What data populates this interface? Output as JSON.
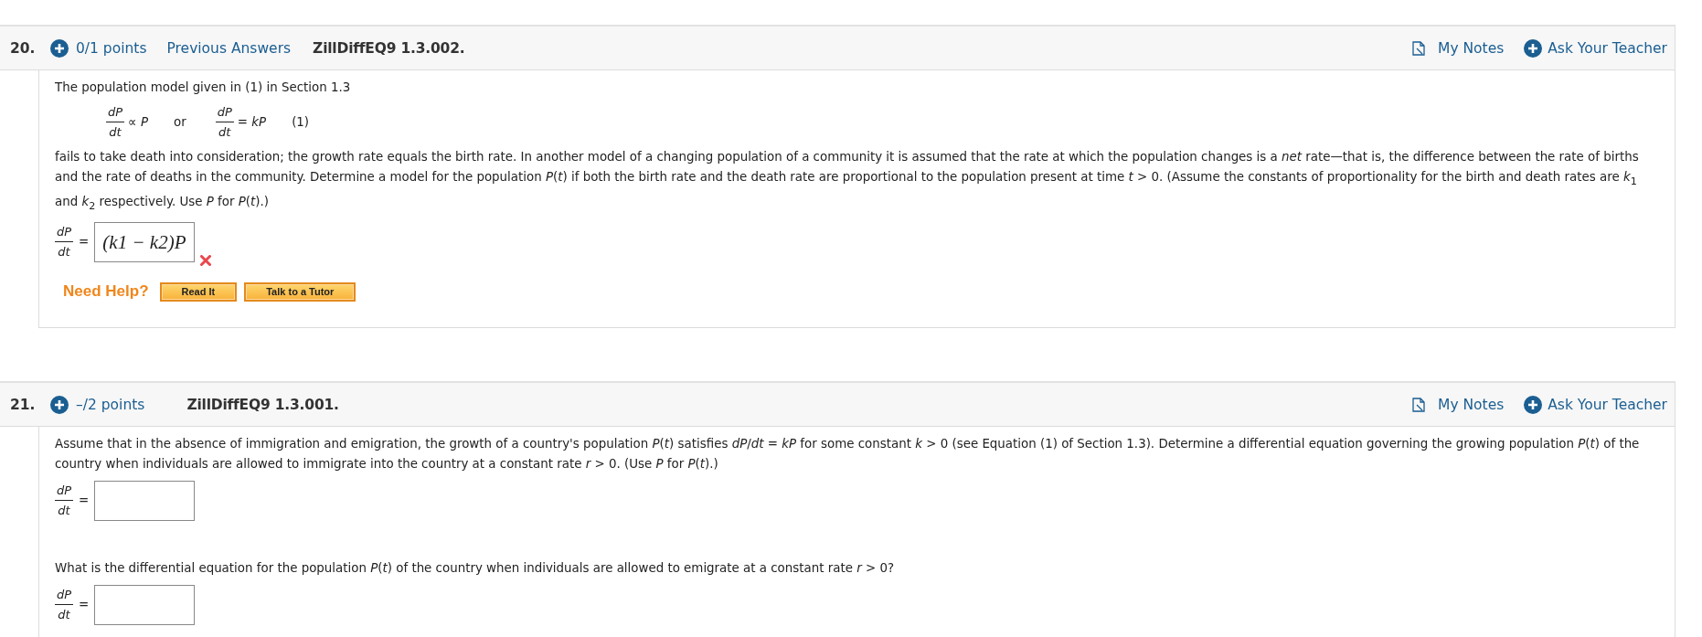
{
  "questions": [
    {
      "number": "20.",
      "points": "0/1 points",
      "previous_answers": "Previous Answers",
      "code": "ZillDiffEQ9 1.3.002.",
      "my_notes": "My Notes",
      "ask_teacher": "Ask Your Teacher",
      "parts": [
        {
          "kind": "text",
          "text": "The population model given in (1) in Section 1.3"
        },
        {
          "kind": "equation",
          "items": [
            {
              "kind": "fraction",
              "num": "dP",
              "den": "dt",
              "rest": "∝ *P*"
            },
            {
              "kind": "word",
              "text": "or"
            },
            {
              "kind": "fraction",
              "num": "dP",
              "den": "dt",
              "rest": "= *kP*"
            },
            {
              "kind": "word",
              "text": "(1)"
            }
          ]
        },
        {
          "kind": "text",
          "text": "fails to take death into consideration; the growth rate equals the birth rate. In another model of a changing population of a community it is assumed that the rate at which the population changes is a *net* rate—that is, the difference between the rate of births and the rate of deaths in the community. Determine a model for the population *P*(*t*) if both the birth rate and the death rate are proportional to the population present at time *t* > 0. (Assume the constants of proportionality for the birth and death rates are *k*$_{1}$ and *k*$_{2}$ respectively. Use *P* for *P*(*t*).)"
        },
        {
          "kind": "answer",
          "num": "dP",
          "den": "dt",
          "eq": "=",
          "value": "(k1 − k2)P",
          "correct": false
        },
        {
          "kind": "help",
          "label": "Need Help?",
          "buttons": [
            "Read It",
            "Talk to a Tutor"
          ]
        }
      ]
    },
    {
      "number": "21.",
      "points": "–/2 points",
      "code": "ZillDiffEQ9 1.3.001.",
      "my_notes": "My Notes",
      "ask_teacher": "Ask Your Teacher",
      "parts": [
        {
          "kind": "text",
          "text": "Assume that in the absence of immigration and emigration, the growth of a country's population *P*(*t*) satisfies *dP*/*dt* = *kP* for some constant *k* > 0 (see Equation (1) of Section 1.3). Determine a differential equation governing the growing population *P*(*t*) of the country when individuals are allowed to immigrate into the country at a constant rate *r* > 0. (Use *P* for *P*(*t*).)"
        },
        {
          "kind": "answer",
          "num": "dP",
          "den": "dt",
          "eq": "="
        },
        {
          "kind": "text",
          "text": "What is the differential equation for the population *P*(*t*) of the country when individuals are allowed to emigrate at a constant rate *r* > 0?"
        },
        {
          "kind": "answer",
          "num": "dP",
          "den": "dt",
          "eq": "="
        }
      ]
    }
  ]
}
